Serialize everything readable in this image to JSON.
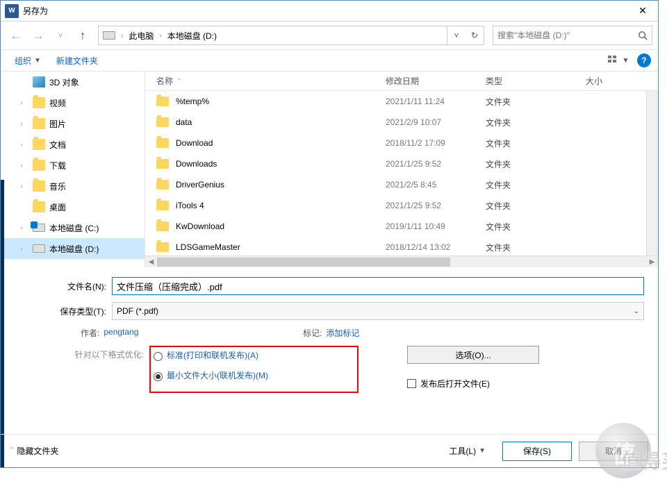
{
  "titlebar": {
    "icon_letter": "W",
    "title": "另存为"
  },
  "nav": {
    "breadcrumb": [
      "此电脑",
      "本地磁盘 (D:)"
    ],
    "search_placeholder": "搜索\"本地磁盘 (D:)\""
  },
  "toolbar": {
    "organize": "组织",
    "new_folder": "新建文件夹"
  },
  "tree": [
    {
      "label": "3D 对象",
      "type": "folder-3d",
      "expand": ""
    },
    {
      "label": "视频",
      "type": "folder",
      "expand": "›"
    },
    {
      "label": "图片",
      "type": "folder",
      "expand": "›"
    },
    {
      "label": "文档",
      "type": "folder",
      "expand": "›"
    },
    {
      "label": "下载",
      "type": "folder",
      "expand": "›"
    },
    {
      "label": "音乐",
      "type": "folder",
      "expand": "›"
    },
    {
      "label": "桌面",
      "type": "folder",
      "expand": ""
    },
    {
      "label": "本地磁盘 (C:)",
      "type": "drive-c",
      "expand": "›"
    },
    {
      "label": "本地磁盘 (D:)",
      "type": "drive",
      "expand": "›",
      "selected": true
    }
  ],
  "columns": {
    "name": "名称",
    "date": "修改日期",
    "type": "类型",
    "size": "大小"
  },
  "files": [
    {
      "name": "%temp%",
      "date": "2021/1/11 11:24",
      "type": "文件夹"
    },
    {
      "name": "data",
      "date": "2021/2/9 10:07",
      "type": "文件夹"
    },
    {
      "name": "Download",
      "date": "2018/11/2 17:09",
      "type": "文件夹"
    },
    {
      "name": "Downloads",
      "date": "2021/1/25 9:52",
      "type": "文件夹"
    },
    {
      "name": "DriverGenius",
      "date": "2021/2/5 8:45",
      "type": "文件夹"
    },
    {
      "name": "iTools 4",
      "date": "2021/1/25 9:52",
      "type": "文件夹"
    },
    {
      "name": "KwDownload",
      "date": "2019/1/11 10:49",
      "type": "文件夹"
    },
    {
      "name": "LDSGameMaster",
      "date": "2018/12/14 13:02",
      "type": "文件夹"
    }
  ],
  "form": {
    "filename_label": "文件名(N):",
    "filename_value": "文件压缩（压缩完成）.pdf",
    "filetype_label": "保存类型(T):",
    "filetype_value": "PDF (*.pdf)",
    "author_label": "作者:",
    "author_value": "pengtang",
    "tags_label": "标记:",
    "tags_value": "添加标记",
    "optimize_label": "针对以下格式优化:",
    "optimize_opts": [
      "标准(打印和联机发布)(A)",
      "最小文件大小(联机发布)(M)"
    ],
    "options_btn": "选项(O)...",
    "publish_open_check": "发布后打开文件(E)"
  },
  "footer": {
    "hide_folders": "隐藏文件夹",
    "tools": "工具(L)",
    "save": "保存(S)",
    "cancel": "取消"
  },
  "watermark": "值得买"
}
